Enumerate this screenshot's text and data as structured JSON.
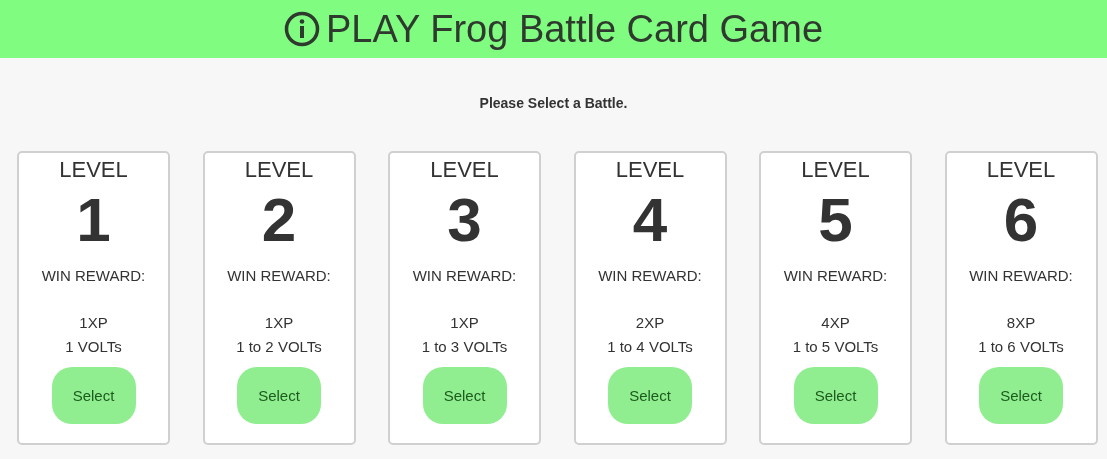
{
  "header": {
    "title": "PLAY Frog Battle Card Game"
  },
  "prompt": "Please Select a Battle.",
  "battles": [
    {
      "level_label": "LEVEL",
      "level": "1",
      "reward_label": "WIN REWARD:",
      "xp": "1XP",
      "volts": "1 VOLTs",
      "button": "Select"
    },
    {
      "level_label": "LEVEL",
      "level": "2",
      "reward_label": "WIN REWARD:",
      "xp": "1XP",
      "volts": "1 to 2 VOLTs",
      "button": "Select"
    },
    {
      "level_label": "LEVEL",
      "level": "3",
      "reward_label": "WIN REWARD:",
      "xp": "1XP",
      "volts": "1 to 3 VOLTs",
      "button": "Select"
    },
    {
      "level_label": "LEVEL",
      "level": "4",
      "reward_label": "WIN REWARD:",
      "xp": "2XP",
      "volts": "1 to 4 VOLTs",
      "button": "Select"
    },
    {
      "level_label": "LEVEL",
      "level": "5",
      "reward_label": "WIN REWARD:",
      "xp": "4XP",
      "volts": "1 to 5 VOLTs",
      "button": "Select"
    },
    {
      "level_label": "LEVEL",
      "level": "6",
      "reward_label": "WIN REWARD:",
      "xp": "8XP",
      "volts": "1 to 6 VOLTs",
      "button": "Select"
    }
  ]
}
